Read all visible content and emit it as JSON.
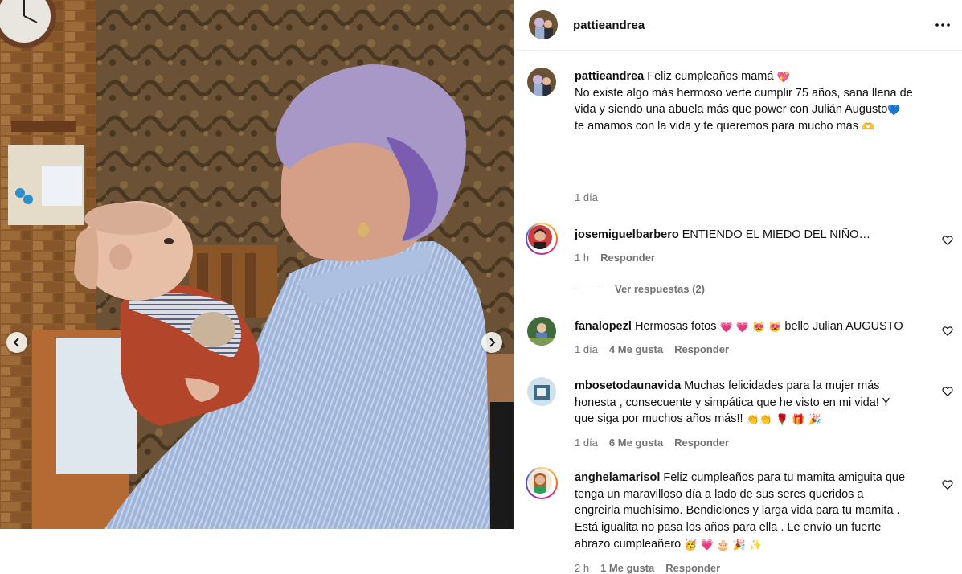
{
  "post": {
    "author": "pattieandrea",
    "caption_text": "Feliz cumpleaños mamá 💖\nNo existe algo más hermoso verte cumplir 75 años, sana llena de vida y siendo una abuela más que power con Julián Augusto💙 te amamos con la vida y te queremos para mucho más 🫶",
    "caption_line1": "Feliz cumpleaños mamá ",
    "caption_line2": "No existe algo más hermoso verte cumplir 75 años, sana llena de",
    "caption_line3": "vida y siendo una abuela más que power con Julián Augusto",
    "caption_line4": "te amamos con la vida y te queremos para mucho más ",
    "timestamp": "1 día"
  },
  "header": {
    "username": "pattieandrea",
    "more_icon": "more-horizontal-icon"
  },
  "comments": [
    {
      "username": "josemiguelbarbero",
      "text": "ENTIENDO EL MIEDO DEL NIÑO…",
      "timestamp": "1 h",
      "likes": "",
      "reply_label": "Responder",
      "view_replies": "Ver respuestas (2)"
    },
    {
      "username": "fanalopezl",
      "text": "Hermosas fotos 💗 💗 😻 😻  bello Julian AUGUSTO",
      "text_a": "Hermosas fotos ",
      "text_b": " bello Julian AUGUSTO",
      "timestamp": "1 día",
      "likes": "4 Me gusta",
      "reply_label": "Responder"
    },
    {
      "username": "mbosetodaunavida",
      "text_1": "Muchas felicidades para la mujer más",
      "text_2": "honesta , consecuente y simpática que he visto en mi vida! Y",
      "text_3": "que siga por muchos años más!! ",
      "timestamp": "1 día",
      "likes": "6 Me gusta",
      "reply_label": "Responder"
    },
    {
      "username": "anghelamarisol",
      "text_1": "Feliz cumpleaños para tu mamita amiguita que",
      "text_2": "tenga un maravilloso día a lado de sus seres queridos a",
      "text_3": "engreirla muchísimo. Bendiciones y larga vida para tu mamita .",
      "text_4": "Está igualita no pasa los años para ella . Le envío un fuerte",
      "text_5": "abrazo cumpleañero ",
      "timestamp": "2 h",
      "likes": "1 Me gusta",
      "reply_label": "Responder"
    }
  ],
  "icons": {
    "like": "heart-outline-icon",
    "prev": "chevron-left-icon",
    "next": "chevron-right-icon"
  },
  "colors": {
    "text": "#111111",
    "muted": "#737373",
    "border": "#dbdbdb",
    "blue_heart": "#3d8fe0",
    "pink_heart": "#e0245e"
  }
}
